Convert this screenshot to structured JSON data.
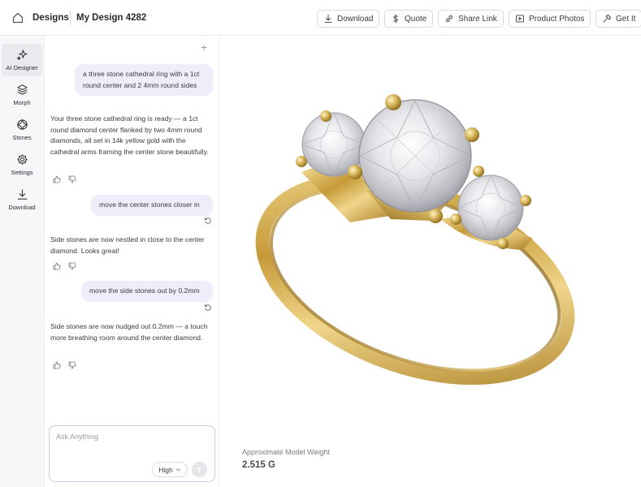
{
  "topbar": {
    "breadcrumb_root": "Designs",
    "design_name": "My Design 4282",
    "buttons": {
      "download": "Download",
      "quote": "Quote",
      "share": "Share Link",
      "photos": "Product Photos",
      "get_it": "Get It"
    }
  },
  "sidebar": {
    "items": [
      {
        "label": "AI Designer",
        "icon": "sparkles-icon",
        "active": true
      },
      {
        "label": "Morph",
        "icon": "layers-icon"
      },
      {
        "label": "Stones",
        "icon": "gem-icon"
      },
      {
        "label": "Settings",
        "icon": "gear-icon"
      },
      {
        "label": "Download",
        "icon": "download-icon"
      }
    ]
  },
  "chat": {
    "messages": [
      {
        "role": "user",
        "text": "a three stone cathedral ring with a 1ct round center and 2 4mm round sides"
      },
      {
        "role": "assistant",
        "text": "Your three stone cathedral ring is ready — a 1ct round diamond center flanked by two 4mm round diamonds, all set in 14k yellow gold with the cathedral arms framing the center stone beautifully."
      },
      {
        "role": "user",
        "text": "move the center stones closer in"
      },
      {
        "role": "assistant",
        "text": "Side stones are now nestled in close to the center diamond. Looks great!"
      },
      {
        "role": "user",
        "text": "move the side stones out by 0.2mm"
      },
      {
        "role": "assistant",
        "text": "Side stones are now nudged out 0.2mm — a touch more breathing room around the center diamond."
      }
    ],
    "input_placeholder": "Ask Anything",
    "quality": "High"
  },
  "viewport": {
    "weight_label": "Approximate Model Weight",
    "weight_value": "2.515 G"
  },
  "colors": {
    "accent": "#efedfa",
    "input_border": "#cfc9ee",
    "gold": "#d4b45c"
  }
}
